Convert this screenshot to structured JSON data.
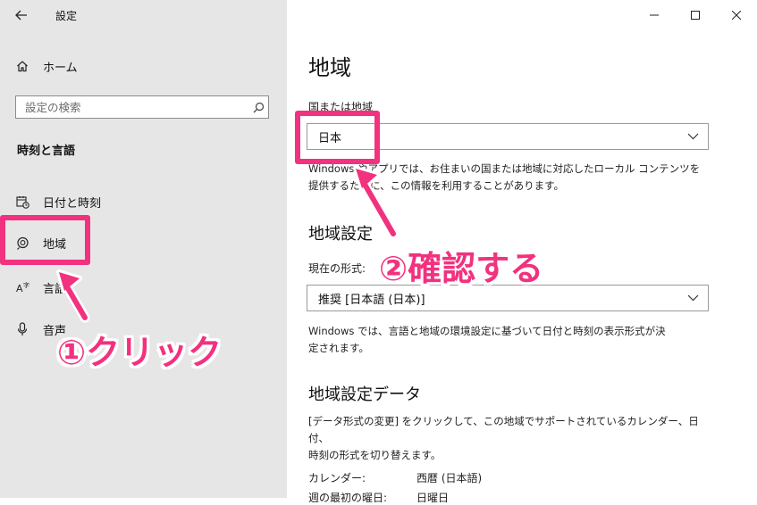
{
  "window": {
    "title": "設定"
  },
  "sidebar": {
    "home_label": "ホーム",
    "search_placeholder": "設定の検索",
    "section_title": "時刻と言語",
    "items": [
      {
        "label": "日付と時刻",
        "icon": "calendar-clock-icon"
      },
      {
        "label": "地域",
        "icon": "globe-icon"
      },
      {
        "label": "言語",
        "icon": "language-icon"
      },
      {
        "label": "音声",
        "icon": "microphone-icon"
      }
    ]
  },
  "main": {
    "title": "地域",
    "country": {
      "label": "国または地域",
      "value": "日本",
      "desc_line1": "Windows やアプリでは、お住まいの国または地域に対応したローカル コンテンツを",
      "desc_line2": "提供するために、この情報を利用することがあります。"
    },
    "regional_format": {
      "heading": "地域設定",
      "label": "現在の形式:",
      "value": "推奨 [日本語 (日本)]",
      "desc_line1": "Windows では、言語と地域の環境設定に基づいて日付と時刻の表示形式が決",
      "desc_line2": "定されます。"
    },
    "format_data": {
      "heading": "地域設定データ",
      "desc_line1": "[データ形式の変更] をクリックして、この地域でサポートされているカレンダー、日付、",
      "desc_line2": "時刻の形式を切り替えます。",
      "rows": [
        {
          "key": "カレンダー:",
          "value": "西暦 (日本語)"
        },
        {
          "key": "週の最初の曜日:",
          "value": "日曜日"
        }
      ]
    }
  },
  "annotations": {
    "step1": "①クリック",
    "step2": "②確認する",
    "color": "#f2317f"
  }
}
